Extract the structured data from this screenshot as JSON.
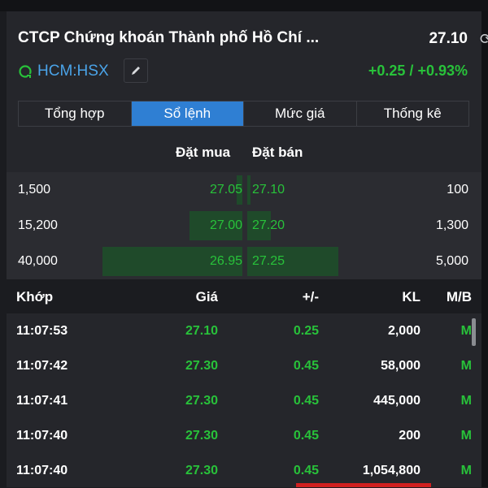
{
  "stock": {
    "title": "CTCP Chứng khoán Thành phố Hồ Chí ...",
    "price": "27.10",
    "exchange": "HCM:HSX",
    "change": "+0.25 / +0.93%"
  },
  "tabs": [
    {
      "label": "Tổng hợp",
      "active": false
    },
    {
      "label": "Sổ lệnh",
      "active": true
    },
    {
      "label": "Mức giá",
      "active": false
    },
    {
      "label": "Thống kê",
      "active": false
    }
  ],
  "order_book": {
    "bid_header": "Đặt mua",
    "ask_header": "Đặt bán",
    "rows": [
      {
        "bid_qty": "1,500",
        "bid_price": "27.05",
        "ask_price": "27.10",
        "ask_qty": "100",
        "bid_depth": 0.04,
        "ask_depth": 0.02
      },
      {
        "bid_qty": "15,200",
        "bid_price": "27.00",
        "ask_price": "27.20",
        "ask_qty": "1,300",
        "bid_depth": 0.38,
        "ask_depth": 0.26
      },
      {
        "bid_qty": "40,000",
        "bid_price": "26.95",
        "ask_price": "27.25",
        "ask_qty": "5,000",
        "bid_depth": 1.0,
        "ask_depth": 1.0
      }
    ]
  },
  "trades": {
    "headers": {
      "time": "Khớp",
      "price": "Giá",
      "change": "+/-",
      "volume": "KL",
      "side": "M/B"
    },
    "rows": [
      {
        "time": "11:07:53",
        "price": "27.10",
        "change": "0.25",
        "volume": "2,000",
        "side": "M"
      },
      {
        "time": "11:07:42",
        "price": "27.30",
        "change": "0.45",
        "volume": "58,000",
        "side": "M"
      },
      {
        "time": "11:07:41",
        "price": "27.30",
        "change": "0.45",
        "volume": "445,000",
        "side": "M"
      },
      {
        "time": "11:07:40",
        "price": "27.30",
        "change": "0.45",
        "volume": "200",
        "side": "M"
      },
      {
        "time": "11:07:40",
        "price": "27.30",
        "change": "0.45",
        "volume": "1,054,800",
        "side": "M"
      }
    ]
  },
  "colors": {
    "up": "#28c23a",
    "link": "#4aa3e8",
    "active_tab": "#2f7fd3",
    "panel": "#25262b"
  }
}
